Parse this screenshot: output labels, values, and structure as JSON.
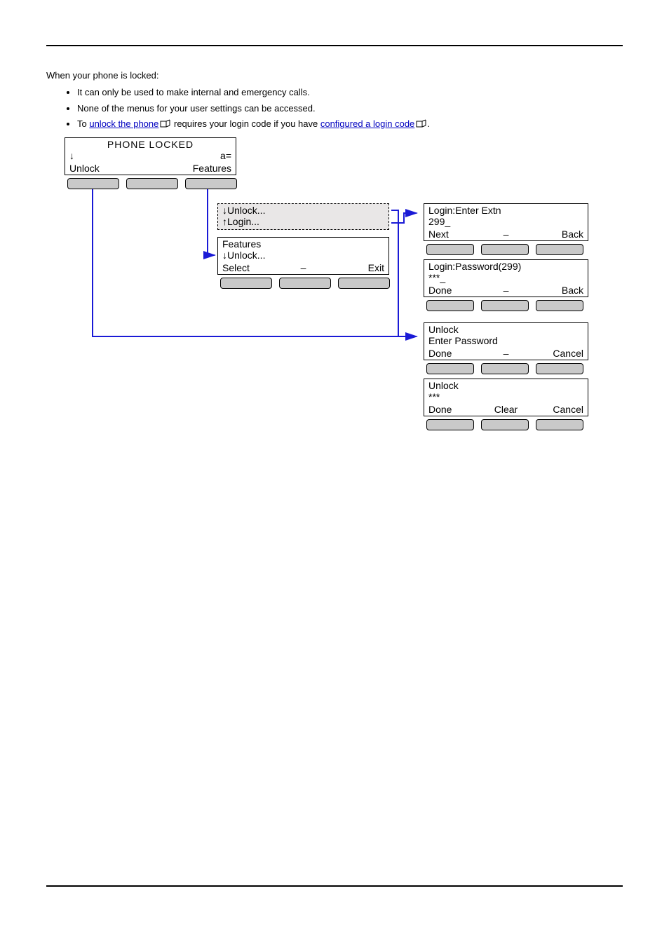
{
  "intro": "When your phone is locked:",
  "bullets": {
    "b1": "It can only be used to make internal and emergency calls.",
    "b2": "None of the menus for your user settings can be accessed.",
    "b3_prefix": "To ",
    "b3_link1": "unlock the phone",
    "b3_mid": " requires your login code if you have ",
    "b3_link2": "configured a login code",
    "b3_suffix": "."
  },
  "screens": {
    "locked": {
      "title": "PHONE LOCKED",
      "down": "↓",
      "hint": "a=",
      "sk_left": "Unlock",
      "sk_right": "Features"
    },
    "popup": {
      "line1": "↓Unlock...",
      "line2": "↑Login..."
    },
    "features": {
      "title": "Features",
      "line2": "↓Unlock...",
      "sk_left": "Select",
      "sk_mid": "–",
      "sk_right": "Exit"
    },
    "login_extn": {
      "line1": "Login:Enter Extn",
      "line2": "299_",
      "sk_left": "Next",
      "sk_mid": "–",
      "sk_right": "Back"
    },
    "login_pw": {
      "line1": "Login:Password(299)",
      "line2": "***_",
      "sk_left": "Done",
      "sk_mid": "–",
      "sk_right": "Back"
    },
    "unlock_enter": {
      "line1": "Unlock",
      "line2": "Enter Password",
      "sk_left": "Done",
      "sk_mid": "–",
      "sk_right": "Cancel"
    },
    "unlock_pw": {
      "line1": "Unlock",
      "line2": "***",
      "sk_left": "Done",
      "sk_mid": "Clear",
      "sk_right": "Cancel"
    }
  }
}
